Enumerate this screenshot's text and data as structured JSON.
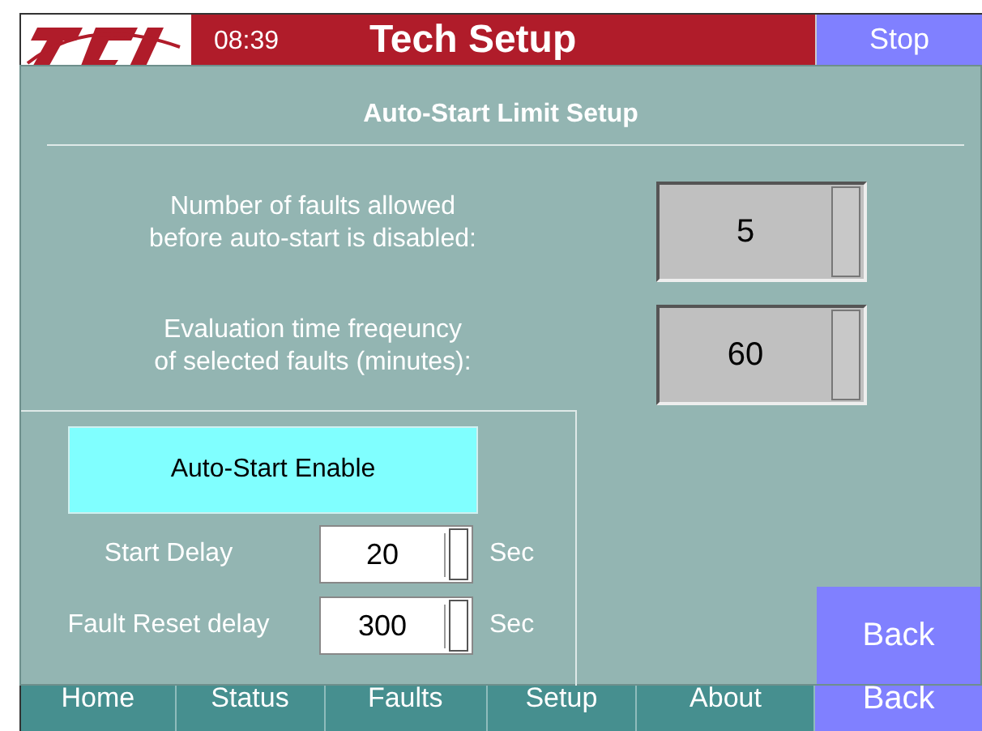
{
  "header": {
    "time": "08:39",
    "title": "Tech Setup",
    "stop_button": "Stop"
  },
  "nav": [
    {
      "label": "Home",
      "kind": "tab"
    },
    {
      "label": "Status",
      "kind": "tab"
    },
    {
      "label": "Faults",
      "kind": "tab"
    },
    {
      "label": "Setup",
      "kind": "tab"
    },
    {
      "label": "About",
      "kind": "tab"
    },
    {
      "label": "Back",
      "kind": "back"
    }
  ],
  "dialog": {
    "title": "Auto-Start Limit Setup",
    "settings": [
      {
        "label_lines": [
          "Number of faults allowed",
          "before auto-start is disabled:"
        ],
        "value": "5"
      },
      {
        "label_lines": [
          "Evaluation time freqeuncy",
          "of selected faults (minutes):"
        ],
        "value": "60"
      }
    ],
    "enable_button": "Auto-Start Enable",
    "delays": [
      {
        "label": "Start Delay",
        "value": "20",
        "unit": "Sec"
      },
      {
        "label": "Fault Reset delay",
        "value": "300",
        "unit": "Sec"
      }
    ],
    "back_button": "Back"
  }
}
